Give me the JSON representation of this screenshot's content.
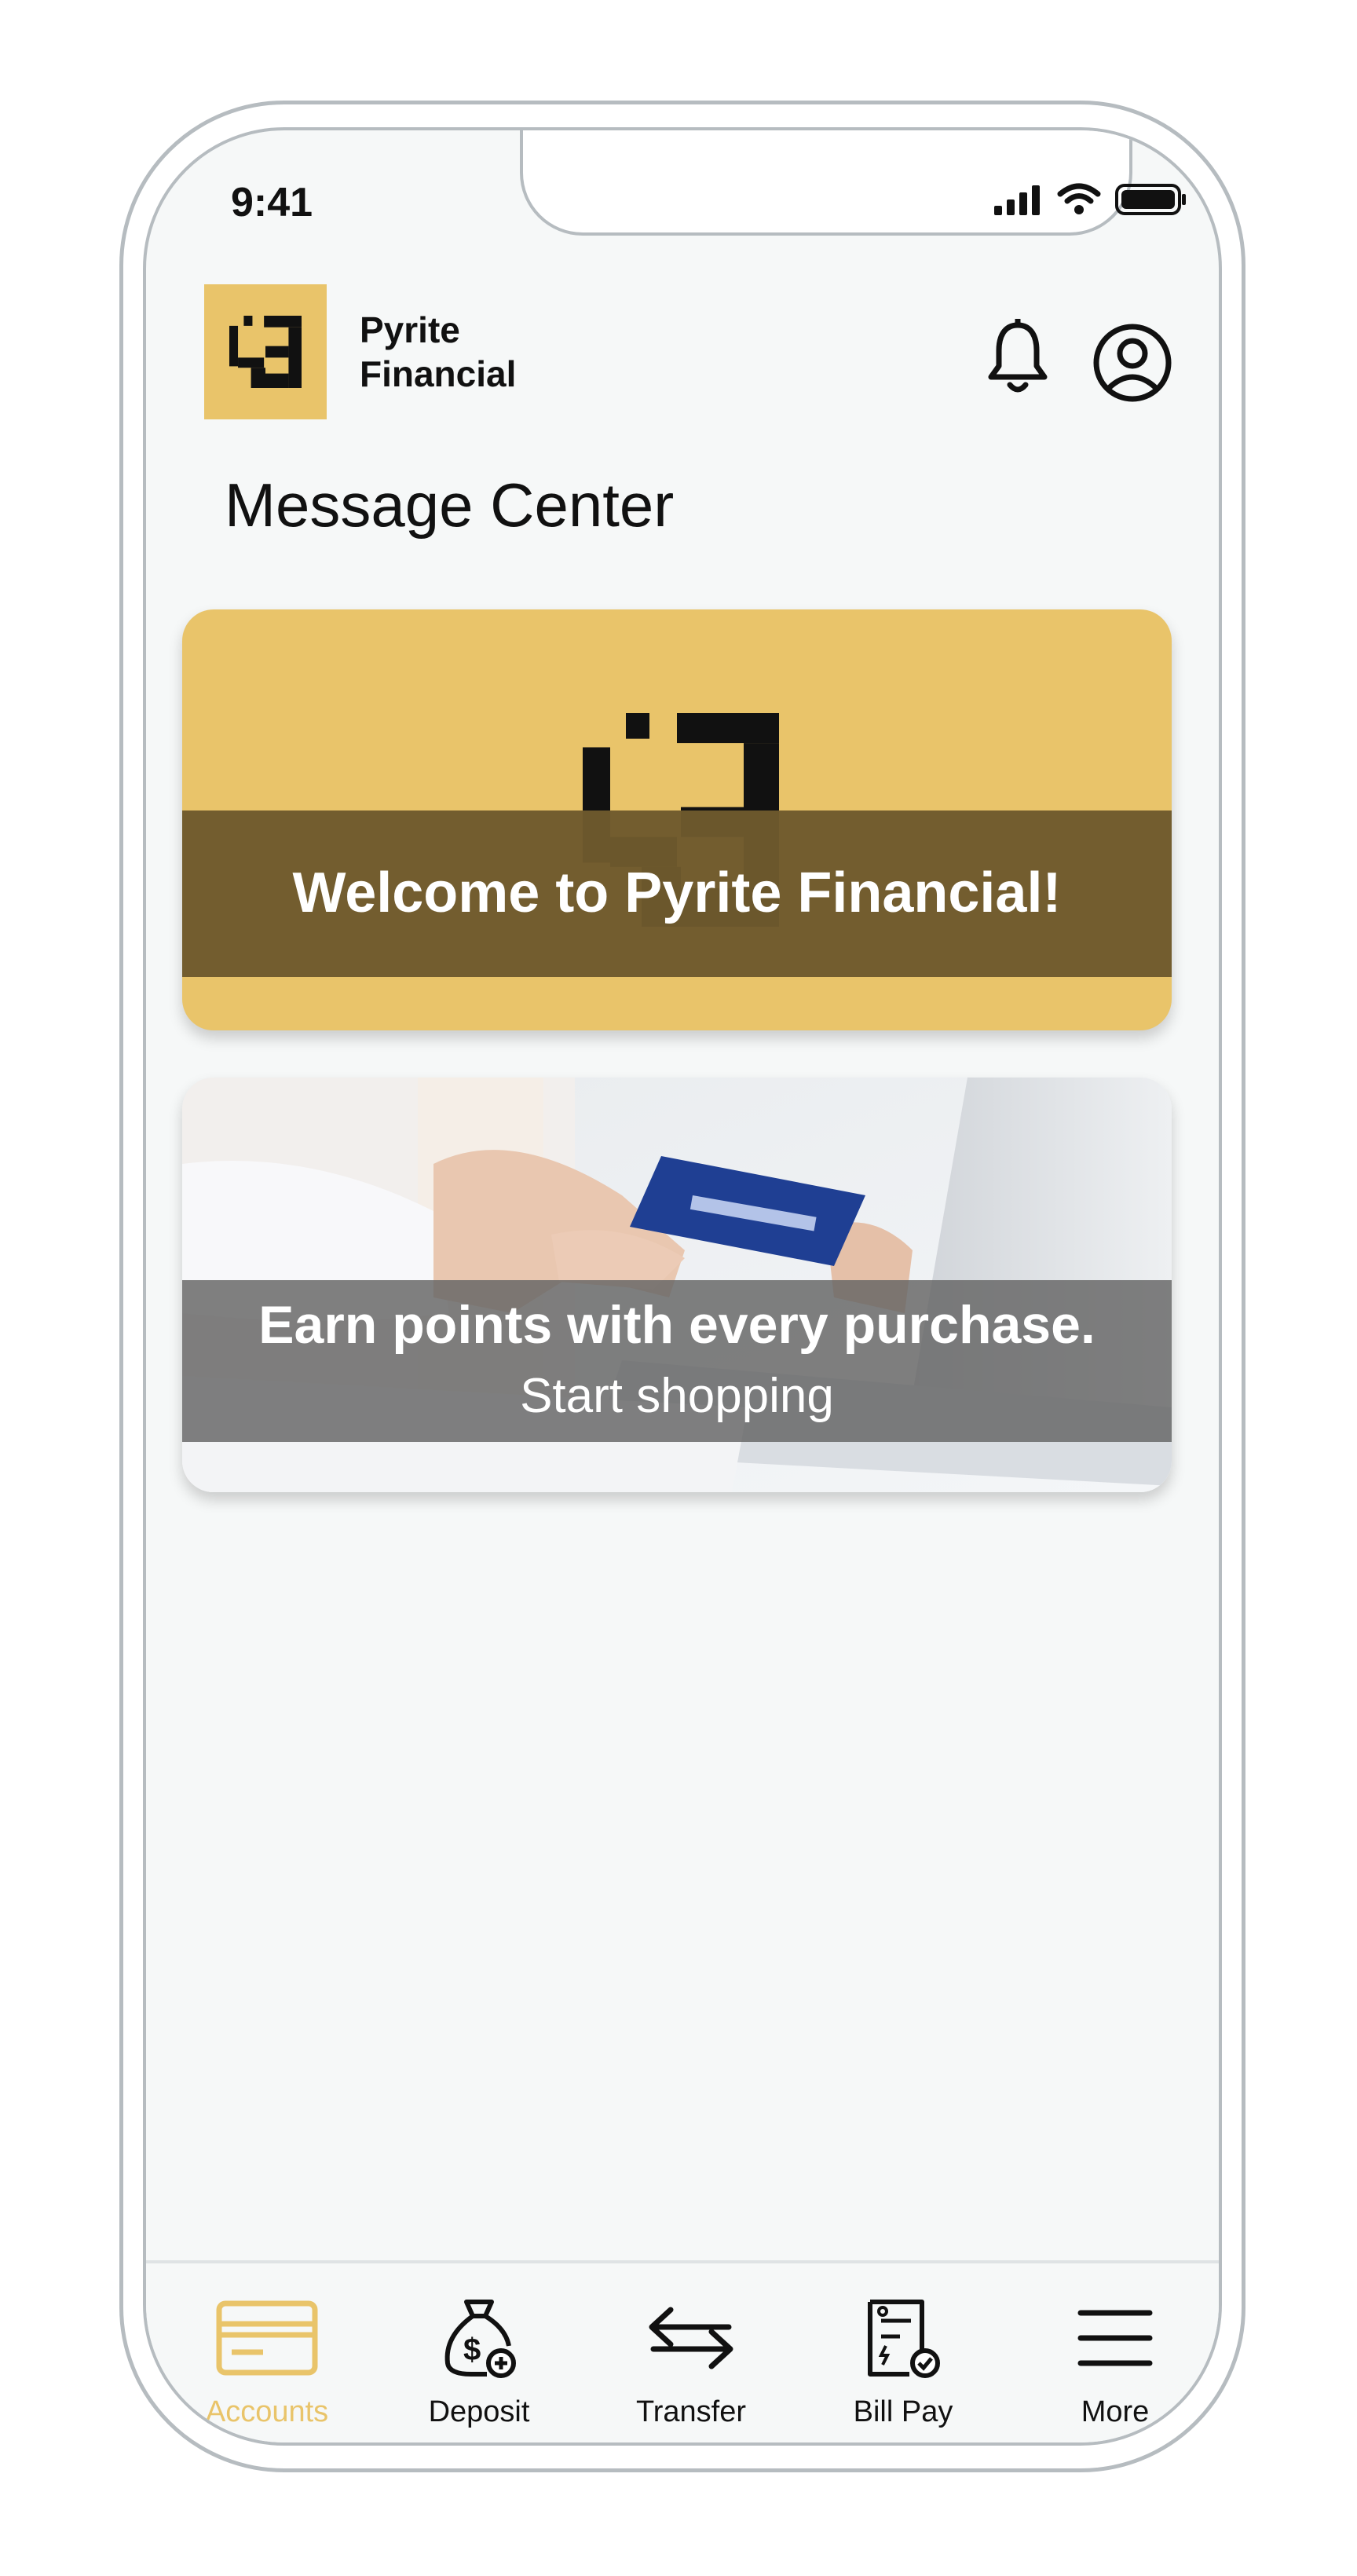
{
  "status_bar": {
    "time": "9:41"
  },
  "header": {
    "brand_line1": "Pyrite",
    "brand_line2": "Financial"
  },
  "page": {
    "title": "Message Center"
  },
  "messages": [
    {
      "title": "Welcome to Pyrite Financial!"
    },
    {
      "title": "Earn points with every purchase.",
      "subtitle": "Start shopping"
    }
  ],
  "bottom_nav": {
    "items": [
      {
        "label": "Accounts",
        "icon": "card-icon",
        "active": true
      },
      {
        "label": "Deposit",
        "icon": "money-bag-icon",
        "active": false
      },
      {
        "label": "Transfer",
        "icon": "transfer-arrows-icon",
        "active": false
      },
      {
        "label": "Bill Pay",
        "icon": "bill-icon",
        "active": false
      },
      {
        "label": "More",
        "icon": "menu-icon",
        "active": false
      }
    ]
  },
  "colors": {
    "accent": "#e9c46a",
    "band_dark": "#6e5a2d",
    "text": "#111111",
    "screen_bg": "#f6f8f8"
  }
}
